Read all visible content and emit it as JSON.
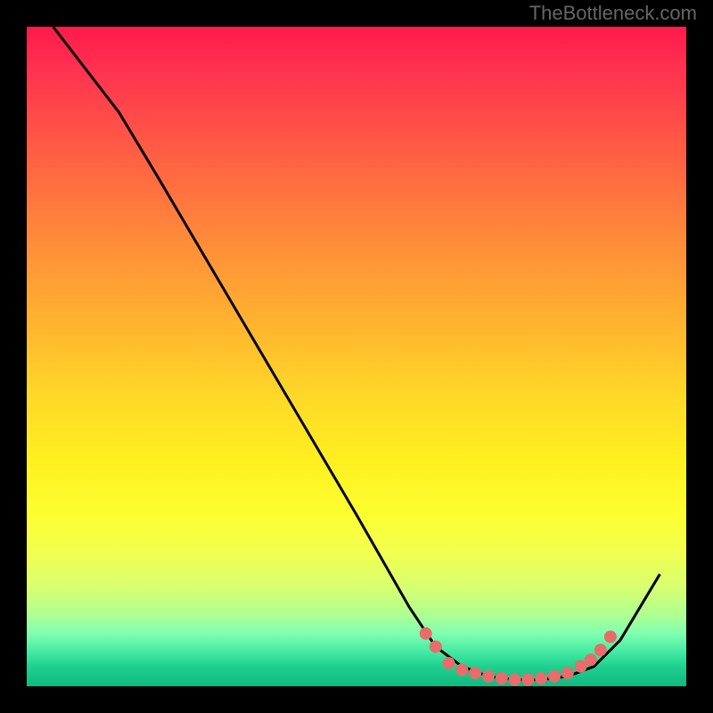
{
  "watermark": "TheBottleneck.com",
  "chart_data": {
    "type": "line",
    "title": "",
    "xlabel": "",
    "ylabel": "",
    "xlim": [
      0,
      100
    ],
    "ylim": [
      0,
      100
    ],
    "curve_points": [
      {
        "x": 4,
        "y": 100
      },
      {
        "x": 14,
        "y": 87
      },
      {
        "x": 20,
        "y": 77
      },
      {
        "x": 30,
        "y": 60
      },
      {
        "x": 40,
        "y": 43
      },
      {
        "x": 50,
        "y": 26
      },
      {
        "x": 58,
        "y": 12
      },
      {
        "x": 62,
        "y": 6
      },
      {
        "x": 66,
        "y": 3
      },
      {
        "x": 70,
        "y": 1.5
      },
      {
        "x": 74,
        "y": 1
      },
      {
        "x": 78,
        "y": 1
      },
      {
        "x": 82,
        "y": 1.5
      },
      {
        "x": 86,
        "y": 3
      },
      {
        "x": 90,
        "y": 7
      },
      {
        "x": 96,
        "y": 17
      }
    ],
    "dot_points": [
      {
        "x": 60.5,
        "y": 8
      },
      {
        "x": 62,
        "y": 6
      },
      {
        "x": 64,
        "y": 3.5
      },
      {
        "x": 66,
        "y": 2.5
      },
      {
        "x": 68,
        "y": 2
      },
      {
        "x": 70,
        "y": 1.5
      },
      {
        "x": 72,
        "y": 1.2
      },
      {
        "x": 74,
        "y": 1
      },
      {
        "x": 76,
        "y": 1
      },
      {
        "x": 78,
        "y": 1.2
      },
      {
        "x": 80,
        "y": 1.5
      },
      {
        "x": 82,
        "y": 2
      },
      {
        "x": 84,
        "y": 3
      },
      {
        "x": 85.5,
        "y": 4
      },
      {
        "x": 87,
        "y": 5.5
      },
      {
        "x": 88.5,
        "y": 7.5
      }
    ],
    "colors": {
      "curve": "#000000",
      "dots": "#e96b6b",
      "gradient_top": "#ff1a4a",
      "gradient_bottom": "#10b880"
    }
  }
}
